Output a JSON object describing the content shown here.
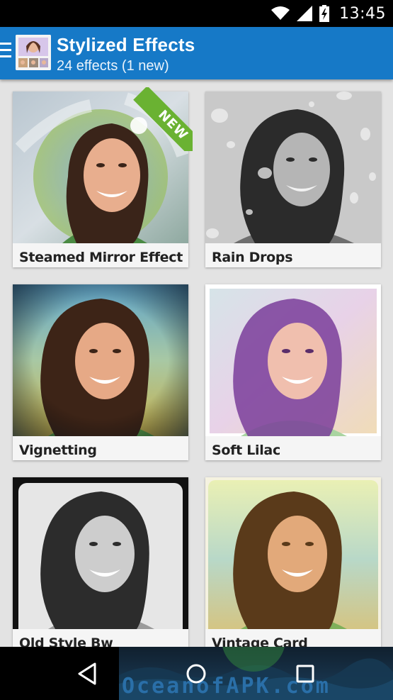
{
  "status_bar": {
    "time": "13:45",
    "icons": [
      "wifi-icon",
      "signal-icon",
      "battery-charging-icon"
    ]
  },
  "app_bar": {
    "title": "Stylized Effects",
    "subtitle": "24 effects (1 new)",
    "menu_icon": "menu-icon",
    "accent_color": "#1679c7"
  },
  "effects": [
    {
      "label": "Steamed Mirror Effect",
      "is_new": true,
      "badge": "NEW"
    },
    {
      "label": "Rain Drops",
      "is_new": false
    },
    {
      "label": "Vignetting",
      "is_new": false
    },
    {
      "label": "Soft Lilac",
      "is_new": false
    },
    {
      "label": "Old Style Bw",
      "is_new": false
    },
    {
      "label": "Vintage Card",
      "is_new": false
    }
  ],
  "nav_bar": {
    "buttons": [
      "back-icon",
      "home-icon",
      "recents-icon"
    ]
  },
  "watermark": {
    "text": "OceanofAPK.com"
  }
}
